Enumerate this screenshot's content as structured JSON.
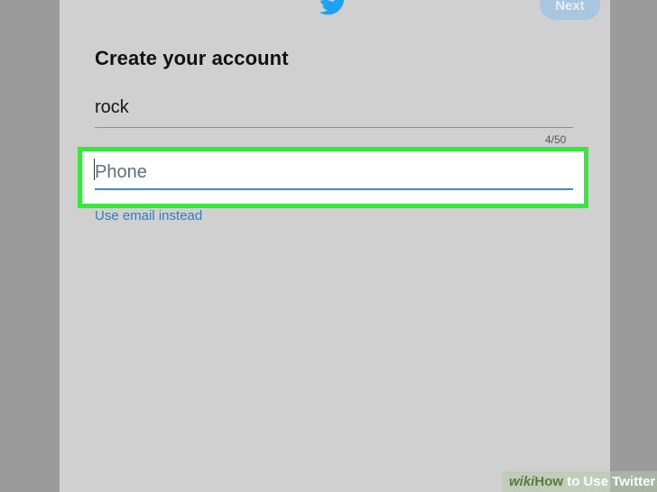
{
  "header": {
    "logo_icon": "twitter-bird-icon",
    "next_label": "Next"
  },
  "form": {
    "title": "Create your account",
    "name_value": "rock",
    "name_counter": "4/50",
    "phone_placeholder": "Phone",
    "email_link": "Use email instead"
  },
  "colors": {
    "brand_blue": "#1da1f2",
    "highlight_green": "#36e83a",
    "link_blue": "#2f7dbf"
  },
  "watermark": {
    "wiki": "wiki",
    "how": "How",
    "rest": " to Use Twitter"
  }
}
